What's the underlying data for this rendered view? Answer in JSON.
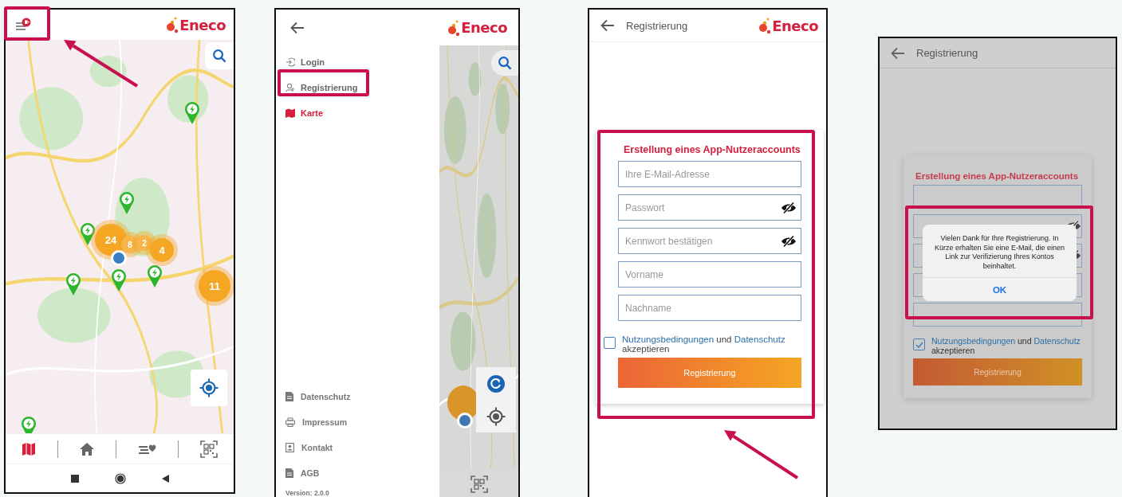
{
  "screens": [
    {
      "kind": "map",
      "logo": "Eneco",
      "clusters": [
        {
          "count": "24"
        },
        {
          "count": "8"
        },
        {
          "count": "2"
        },
        {
          "count": "4"
        },
        {
          "count": "11"
        }
      ],
      "bottom_nav": [
        {
          "selected": true
        },
        {
          "selected": false
        },
        {
          "selected": false
        },
        {
          "selected": false
        }
      ]
    },
    {
      "kind": "menu",
      "logo": "Eneco",
      "menu_items": [
        {
          "label": "Login",
          "selected": false
        },
        {
          "label": "Registrierung",
          "selected": false
        },
        {
          "label": "Karte",
          "selected": true
        }
      ],
      "footer_links": [
        {
          "label": "Datenschutz"
        },
        {
          "label": "Impressum"
        },
        {
          "label": "Kontakt"
        },
        {
          "label": "AGB"
        }
      ],
      "version": "Version: 2.0.0"
    },
    {
      "kind": "form",
      "title": "Registrierung",
      "logo": "Eneco",
      "form": {
        "heading": "Erstellung eines App-Nutzeraccounts",
        "fields": [
          {
            "kind": "text",
            "placeholder": "Ihre E-Mail-Adresse"
          },
          {
            "kind": "password",
            "placeholder": "Passwort"
          },
          {
            "kind": "password",
            "placeholder": "Kennwort bestätigen"
          },
          {
            "kind": "text",
            "placeholder": "Vorname"
          },
          {
            "kind": "text",
            "placeholder": "Nachname"
          }
        ],
        "terms": {
          "checked": false,
          "link_terms": "Nutzungsbedingungen",
          "joiner": "und",
          "link_privacy": "Datenschutz",
          "suffix": "akzeptieren"
        },
        "submit": "Registrierung"
      }
    },
    {
      "kind": "dialog",
      "title": "Registrierung",
      "form": {
        "heading": "Erstellung eines App-Nutzeraccounts",
        "fields": [
          {
            "kind": "text"
          },
          {
            "kind": "password"
          },
          {
            "kind": "password"
          },
          {
            "kind": "text"
          },
          {
            "kind": "text"
          }
        ],
        "terms": {
          "checked": true,
          "link_terms": "Nutzungsbedingungen",
          "joiner": "und",
          "link_privacy": "Datenschutz",
          "suffix": "akzeptieren"
        },
        "submit": "Registrierung"
      },
      "dialog": {
        "message": "Vielen Dank für Ihre Registrierung. In Kürze erhalten Sie eine E-Mail, die einen Link zur Verifizierung Ihres Kontos beinhaltet.",
        "button": "OK"
      }
    }
  ]
}
